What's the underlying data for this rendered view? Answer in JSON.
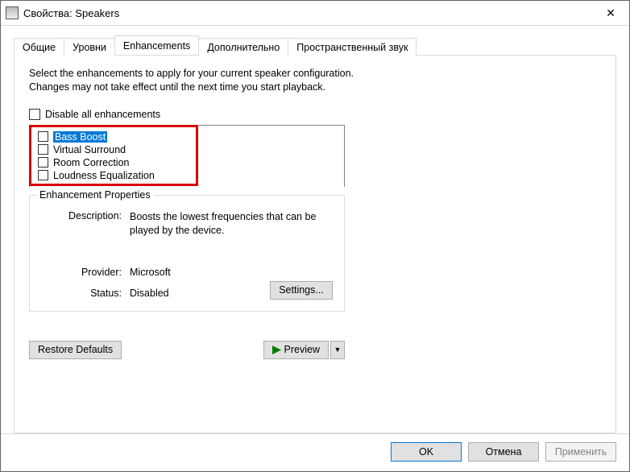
{
  "window": {
    "title": "Свойства: Speakers",
    "close_glyph": "✕"
  },
  "tabs": {
    "t0": "Общие",
    "t1": "Уровни",
    "t2": "Enhancements",
    "t3": "Дополнительно",
    "t4": "Пространственный звук"
  },
  "content": {
    "intro": "Select the enhancements to apply for your current speaker configuration. Changes may not take effect until the next time you start playback.",
    "disable_all_label": "Disable all enhancements",
    "enhancements": {
      "e0": "Bass Boost",
      "e1": "Virtual Surround",
      "e2": "Room Correction",
      "e3": "Loudness Equalization"
    },
    "group_title": "Enhancement Properties",
    "props": {
      "description_label": "Description:",
      "description_value": "Boosts the lowest frequencies that can be played by the device.",
      "provider_label": "Provider:",
      "provider_value": "Microsoft",
      "status_label": "Status:",
      "status_value": "Disabled"
    },
    "settings_button": "Settings...",
    "restore_button": "Restore Defaults",
    "preview_button": "Preview",
    "preview_glyph": "▼"
  },
  "footer": {
    "ok": "OK",
    "cancel": "Отмена",
    "apply": "Применить"
  },
  "colors": {
    "highlight_red": "#d90000",
    "selection_blue": "#0078d7"
  }
}
